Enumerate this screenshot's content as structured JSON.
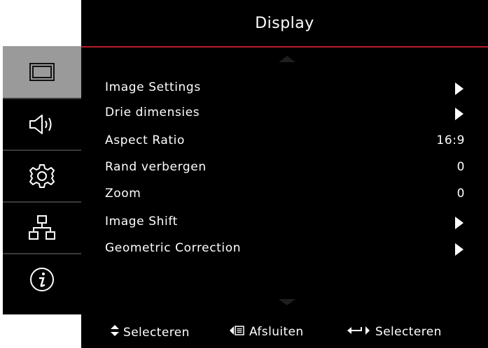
{
  "header": {
    "title": "Display"
  },
  "sidebar": {
    "tabs": [
      {
        "icon": "display-icon",
        "active": true
      },
      {
        "icon": "speaker-icon",
        "active": false
      },
      {
        "icon": "gear-icon",
        "active": false
      },
      {
        "icon": "network-icon",
        "active": false
      },
      {
        "icon": "info-icon",
        "active": false
      }
    ]
  },
  "menu": {
    "items": [
      {
        "label": "Image Settings",
        "value": "",
        "has_submenu": true
      },
      {
        "label": "Drie dimensies",
        "value": "",
        "has_submenu": true
      },
      {
        "label": "Aspect Ratio",
        "value": "16:9",
        "has_submenu": false
      },
      {
        "label": "Rand verbergen",
        "value": "0",
        "has_submenu": false
      },
      {
        "label": "Zoom",
        "value": "0",
        "has_submenu": false
      },
      {
        "label": "Image Shift",
        "value": "",
        "has_submenu": true
      },
      {
        "label": "Geometric Correction",
        "value": "",
        "has_submenu": true
      }
    ]
  },
  "footer": {
    "hint_updown": "Selecteren",
    "hint_menu": "Afsluiten",
    "hint_enter": "Selecteren"
  },
  "colors": {
    "accent_rule": "#b81d2a",
    "background": "#000000",
    "active_tab": "#9a9a9a"
  }
}
